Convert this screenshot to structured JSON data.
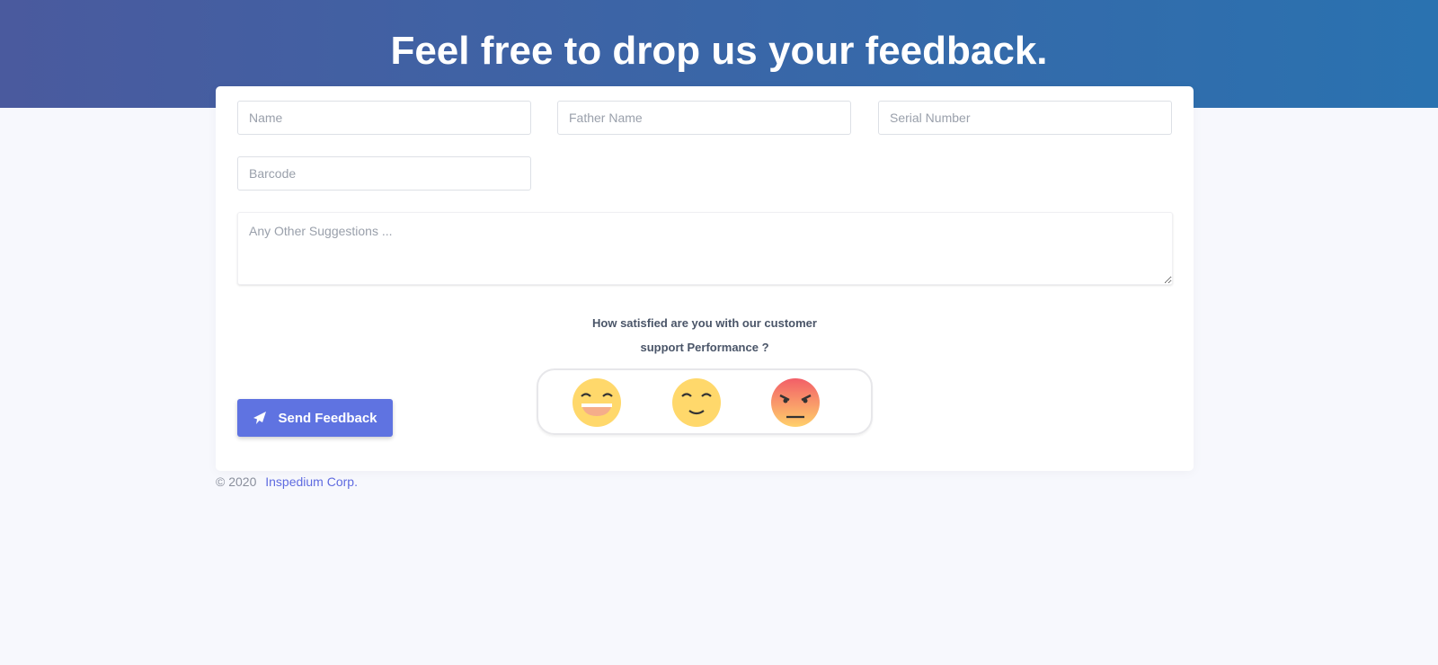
{
  "header": {
    "title": "Feel free to drop us your feedback."
  },
  "form": {
    "name_placeholder": "Name",
    "father_name_placeholder": "Father Name",
    "serial_placeholder": "Serial Number",
    "barcode_placeholder": "Barcode",
    "suggestions_placeholder": "Any Other Suggestions ...",
    "question_line1": "How satisfied are you with our customer",
    "question_line2": "support Performance ?",
    "ratings": [
      "very-happy-emoji-icon",
      "smile-emoji-icon",
      "angry-emoji-icon"
    ],
    "submit_label": "Send Feedback"
  },
  "footer": {
    "copyright": "© 2020",
    "company": "Inspedium Corp."
  },
  "colors": {
    "accent": "#5f73e1",
    "header_start": "#4a5a9e",
    "header_end": "#2a72b0"
  }
}
